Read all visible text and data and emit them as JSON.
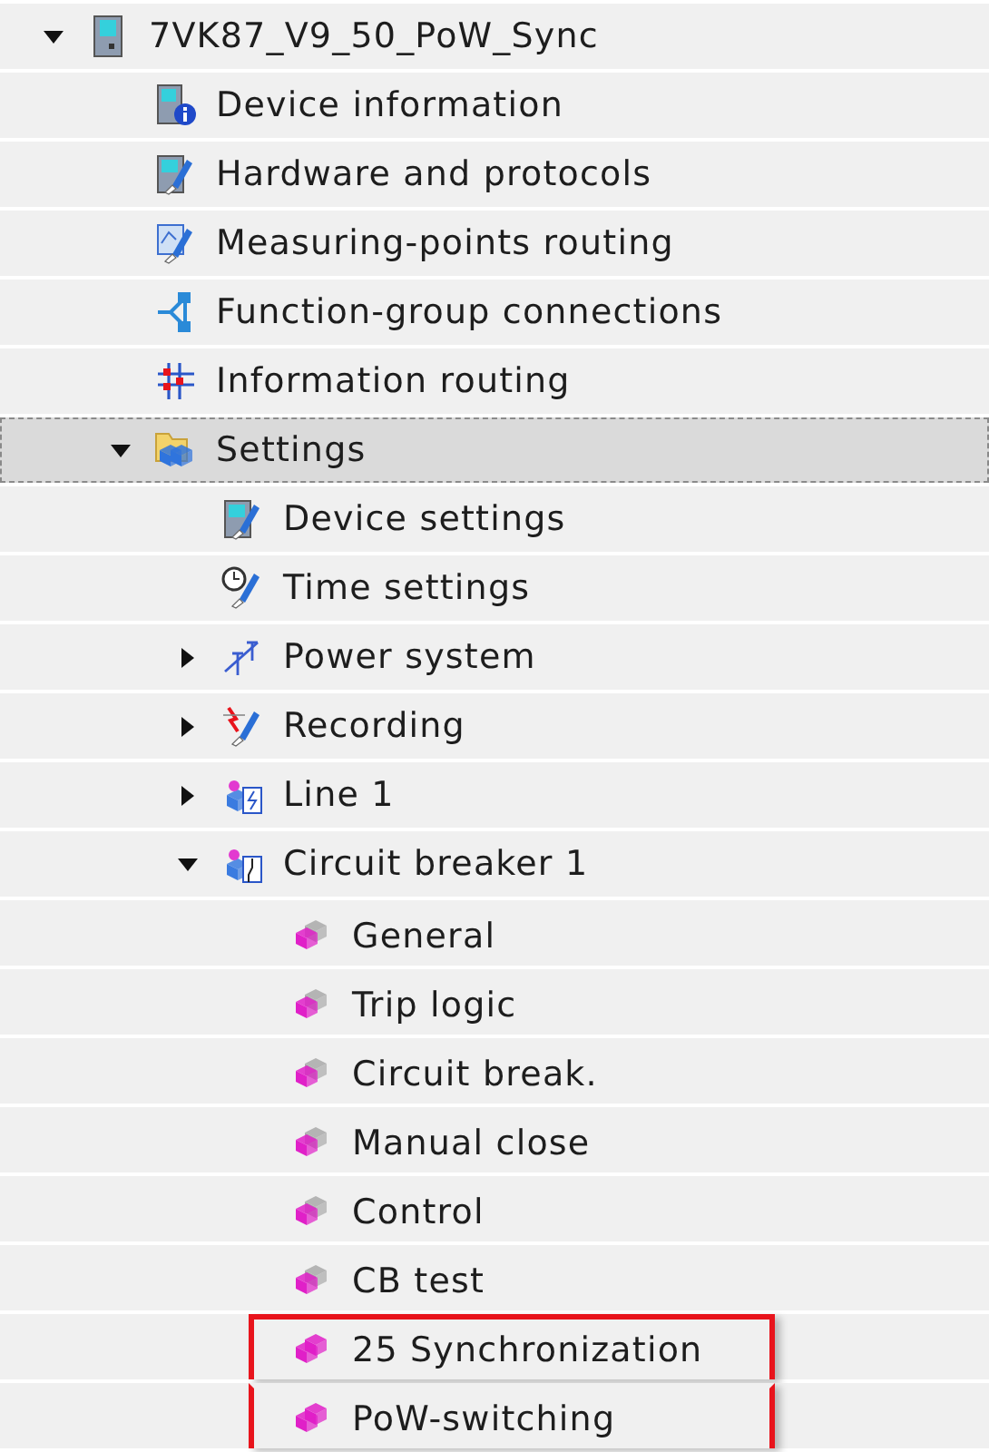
{
  "tree": [
    {
      "label": "7VK87_V9_50_PoW_Sync",
      "kind": "device",
      "expanded": true,
      "selected": false,
      "children": [
        {
          "label": "Device information",
          "kind": "device-info",
          "selected": false
        },
        {
          "label": "Hardware and protocols",
          "kind": "hardware",
          "selected": false
        },
        {
          "label": "Measuring-points routing",
          "kind": "routing",
          "selected": false
        },
        {
          "label": "Function-group connections",
          "kind": "connections",
          "selected": false
        },
        {
          "label": "Information routing",
          "kind": "info-routing",
          "selected": false
        },
        {
          "label": "Settings",
          "kind": "settings-folder",
          "expanded": true,
          "selected": true,
          "children": [
            {
              "label": "Device settings",
              "kind": "hardware",
              "selected": false
            },
            {
              "label": "Time settings",
              "kind": "time",
              "selected": false
            },
            {
              "label": "Power system",
              "kind": "power-system",
              "expanded": false,
              "selected": false
            },
            {
              "label": "Recording",
              "kind": "recording",
              "expanded": false,
              "selected": false
            },
            {
              "label": "Line 1",
              "kind": "function-group-line",
              "expanded": false,
              "selected": false
            },
            {
              "label": "Circuit breaker 1",
              "kind": "function-group-cb",
              "expanded": true,
              "selected": false,
              "children": [
                {
                  "label": "General",
                  "kind": "block",
                  "selected": false,
                  "highlighted": false
                },
                {
                  "label": "Trip logic",
                  "kind": "block",
                  "selected": false,
                  "highlighted": false
                },
                {
                  "label": "Circuit break.",
                  "kind": "block",
                  "selected": false,
                  "highlighted": false
                },
                {
                  "label": "Manual close",
                  "kind": "block",
                  "selected": false,
                  "highlighted": false
                },
                {
                  "label": "Control",
                  "kind": "block",
                  "selected": false,
                  "highlighted": false
                },
                {
                  "label": "CB test",
                  "kind": "block",
                  "selected": false,
                  "highlighted": false
                },
                {
                  "label": "25 Synchronization",
                  "kind": "block-new",
                  "selected": false,
                  "highlighted": true
                },
                {
                  "label": "PoW-switching",
                  "kind": "block-new",
                  "selected": false,
                  "highlighted": true
                }
              ]
            }
          ]
        }
      ]
    }
  ]
}
